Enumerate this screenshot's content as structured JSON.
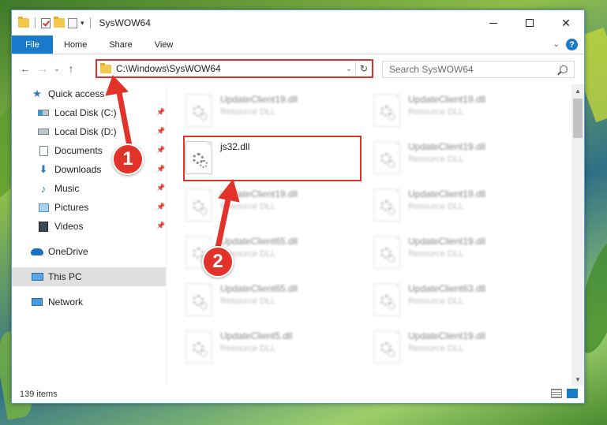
{
  "window": {
    "title": "SysWOW64"
  },
  "ribbon": {
    "tabs": [
      "File",
      "Home",
      "Share",
      "View"
    ],
    "help_label": "?"
  },
  "nav": {
    "back": "←",
    "forward": "→",
    "recent": "⌄",
    "up": "↑",
    "address_path": "C:\\Windows\\SysWOW64",
    "refresh": "↻",
    "search_placeholder": "Search SysWOW64"
  },
  "sidebar": {
    "items": [
      {
        "label": "Quick access",
        "icon": "star-icon",
        "pinned": false
      },
      {
        "label": "Local Disk (C:)",
        "icon": "drive-icon",
        "pinned": true
      },
      {
        "label": "Local Disk (D:)",
        "icon": "drive-icon",
        "pinned": true
      },
      {
        "label": "Documents",
        "icon": "document-icon",
        "pinned": true
      },
      {
        "label": "Downloads",
        "icon": "download-icon",
        "pinned": true
      },
      {
        "label": "Music",
        "icon": "music-icon",
        "pinned": true
      },
      {
        "label": "Pictures",
        "icon": "pictures-icon",
        "pinned": true
      },
      {
        "label": "Videos",
        "icon": "video-icon",
        "pinned": true
      },
      {
        "label": "OneDrive",
        "icon": "cloud-icon",
        "pinned": false
      },
      {
        "label": "This PC",
        "icon": "computer-icon",
        "pinned": false,
        "selected": true
      },
      {
        "label": "Network",
        "icon": "network-icon",
        "pinned": false
      }
    ]
  },
  "files": [
    {
      "name": "UpdateClient19.dll",
      "type": "Resource DLL",
      "blurred": true
    },
    {
      "name": "UpdateClient19.dll",
      "type": "Resource DLL",
      "blurred": true
    },
    {
      "name": "js32.dll",
      "type": "",
      "blurred": false
    },
    {
      "name": "UpdateClient19.dll",
      "type": "Resource DLL",
      "blurred": true
    },
    {
      "name": "UpdateClient19.dll",
      "type": "Resource DLL",
      "blurred": true
    },
    {
      "name": "UpdateClient19.dll",
      "type": "Resource DLL",
      "blurred": true
    },
    {
      "name": "UpdateClient65.dll",
      "type": "Resource DLL",
      "blurred": true
    },
    {
      "name": "UpdateClient19.dll",
      "type": "Resource DLL",
      "blurred": true
    },
    {
      "name": "UpdateClient65.dll",
      "type": "Resource DLL",
      "blurred": true
    },
    {
      "name": "UpdateClient63.dll",
      "type": "Resource DLL",
      "blurred": true
    },
    {
      "name": "UpdateClient5.dll",
      "type": "Resource DLL",
      "blurred": true
    },
    {
      "name": "UpdateClient19.dll",
      "type": "Resource DLL",
      "blurred": true
    }
  ],
  "status": {
    "item_count": "139 items"
  },
  "annotations": {
    "badge1": "1",
    "badge2": "2",
    "color": "#e2332a"
  }
}
